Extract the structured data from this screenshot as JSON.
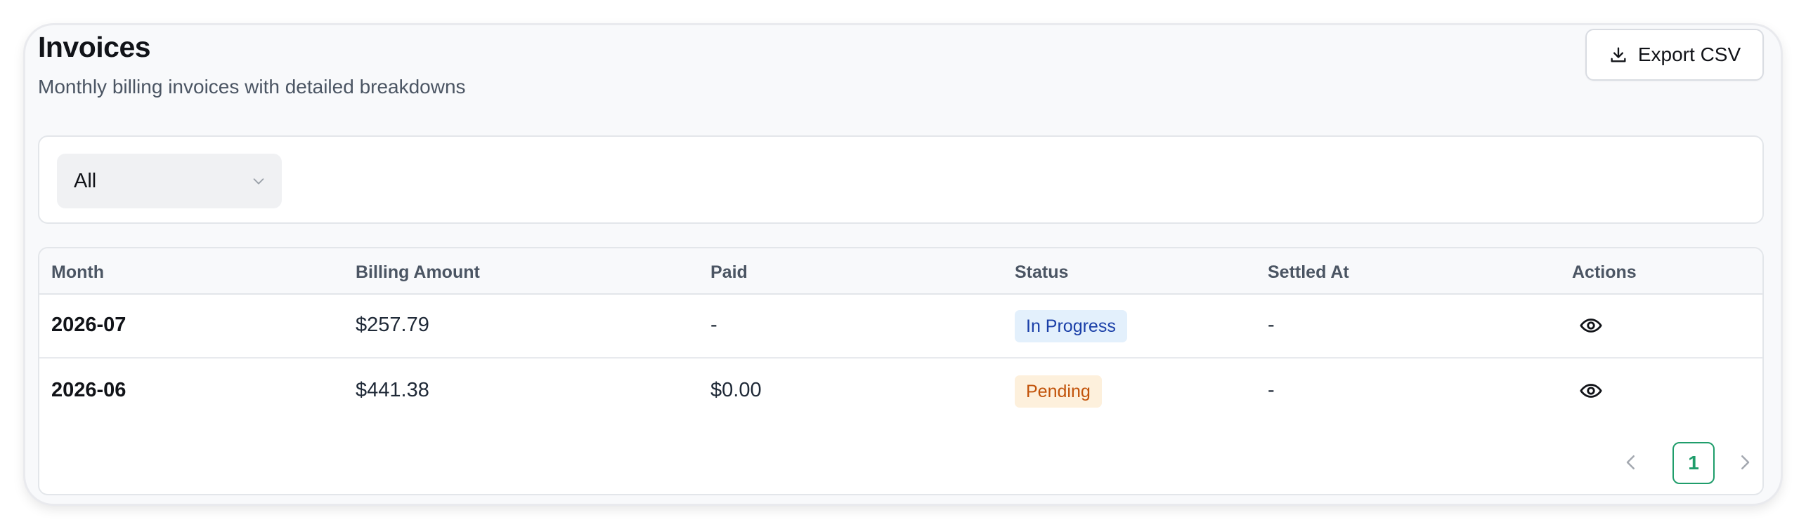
{
  "header": {
    "title": "Invoices",
    "subtitle": "Monthly billing invoices with detailed breakdowns",
    "export_label": "Export CSV",
    "export_icon": "download-icon"
  },
  "filter": {
    "selected": "All",
    "icon": "chevron-down-icon"
  },
  "table": {
    "columns": [
      "Month",
      "Billing Amount",
      "Paid",
      "Status",
      "Settled At",
      "Actions"
    ],
    "rows": [
      {
        "month": "2026-07",
        "billing_amount": "$257.79",
        "paid": "-",
        "status": "In Progress",
        "settled_at": "-",
        "action_icon": "eye-icon"
      },
      {
        "month": "2026-06",
        "billing_amount": "$441.38",
        "paid": "$0.00",
        "status": "Pending",
        "settled_at": "-",
        "action_icon": "eye-icon"
      }
    ]
  },
  "pagination": {
    "current_page": "1",
    "prev_icon": "chevron-left-icon",
    "next_icon": "chevron-right-icon"
  },
  "colors": {
    "accent": "#1f9d6b",
    "in_progress_bg": "#e3f0fc",
    "in_progress_text": "#1a3fa8",
    "pending_bg": "#fdf0dc",
    "pending_text": "#c2530a"
  }
}
